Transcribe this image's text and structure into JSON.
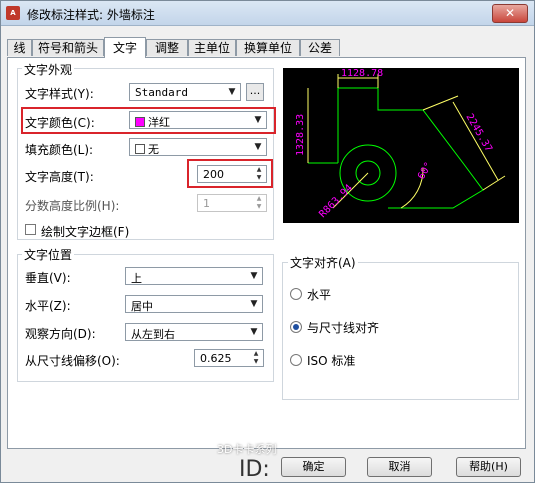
{
  "window": {
    "title": "修改标注样式: 外墙标注",
    "app_icon": "A"
  },
  "tabs": [
    {
      "label": "线"
    },
    {
      "label": "符号和箭头"
    },
    {
      "label": "文字",
      "active": true
    },
    {
      "label": "调整"
    },
    {
      "label": "主单位"
    },
    {
      "label": "换算单位"
    },
    {
      "label": "公差"
    }
  ],
  "text_appearance": {
    "group_title": "文字外观",
    "style_label": "文字样式(Y):",
    "style_value": "Standard",
    "ellipsis": "...",
    "color_label": "文字颜色(C):",
    "color_value": "洋红",
    "color_hex": "#ff00ff",
    "fill_label": "填充颜色(L):",
    "fill_value": "无",
    "height_label": "文字高度(T):",
    "height_value": "200",
    "fraction_label": "分数高度比例(H):",
    "fraction_value": "1",
    "frame_label": "绘制文字边框(F)"
  },
  "text_placement": {
    "group_title": "文字位置",
    "vertical_label": "垂直(V):",
    "vertical_value": "上",
    "horizontal_label": "水平(Z):",
    "horizontal_value": "居中",
    "view_label": "观察方向(D):",
    "view_value": "从左到右",
    "offset_label": "从尺寸线偏移(O):",
    "offset_value": "0.625"
  },
  "text_alignment": {
    "group_title": "文字对齐(A)",
    "options": [
      {
        "label": "水平",
        "checked": false
      },
      {
        "label": "与尺寸线对齐",
        "checked": true
      },
      {
        "label": "ISO 标准",
        "checked": false
      }
    ]
  },
  "preview": {
    "top_dim": "1128.78",
    "left_dim": "1328.33",
    "right_dim": "2245.37",
    "radius_dim": "R863.94",
    "angle_dim": "60°"
  },
  "buttons": {
    "ok": "确定",
    "cancel": "取消",
    "help": "帮助(H)"
  },
  "watermark": {
    "text": "3D卡卡系列",
    "id_text": "ID:"
  },
  "colors": {
    "highlight": "#d9242b",
    "preview_bg": "#000000",
    "dim_magenta": "#ff00ff",
    "geometry_green": "#00ff00",
    "geometry_yellow": "#ffff66"
  }
}
